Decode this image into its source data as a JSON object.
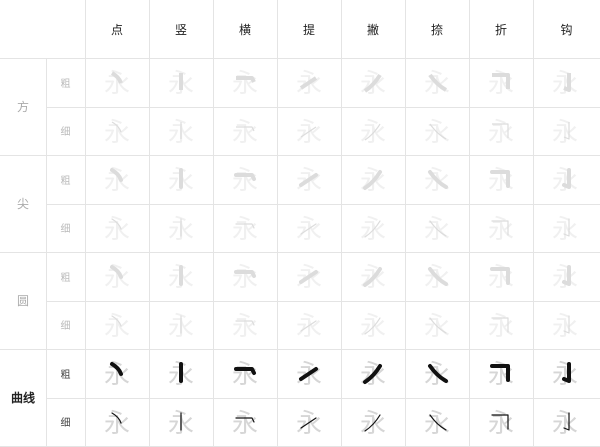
{
  "columns": [
    "点",
    "竖",
    "横",
    "提",
    "撇",
    "捺",
    "折",
    "钩"
  ],
  "groups": [
    {
      "label": "方",
      "active": false,
      "rows": [
        "粗",
        "细"
      ]
    },
    {
      "label": "尖",
      "active": false,
      "rows": [
        "粗",
        "细"
      ]
    },
    {
      "label": "圆",
      "active": false,
      "rows": [
        "粗",
        "细"
      ]
    },
    {
      "label": "曲线",
      "active": true,
      "rows": [
        "粗",
        "细"
      ]
    }
  ],
  "colors": {
    "grid_line": "#e4e4e4",
    "ghost_char": "#f0f0f0",
    "ghost_char_active": "#d6d6d6",
    "stroke_inactive": "#dcdcdc",
    "stroke_active": "#111111"
  },
  "ghost_glyph": "永"
}
